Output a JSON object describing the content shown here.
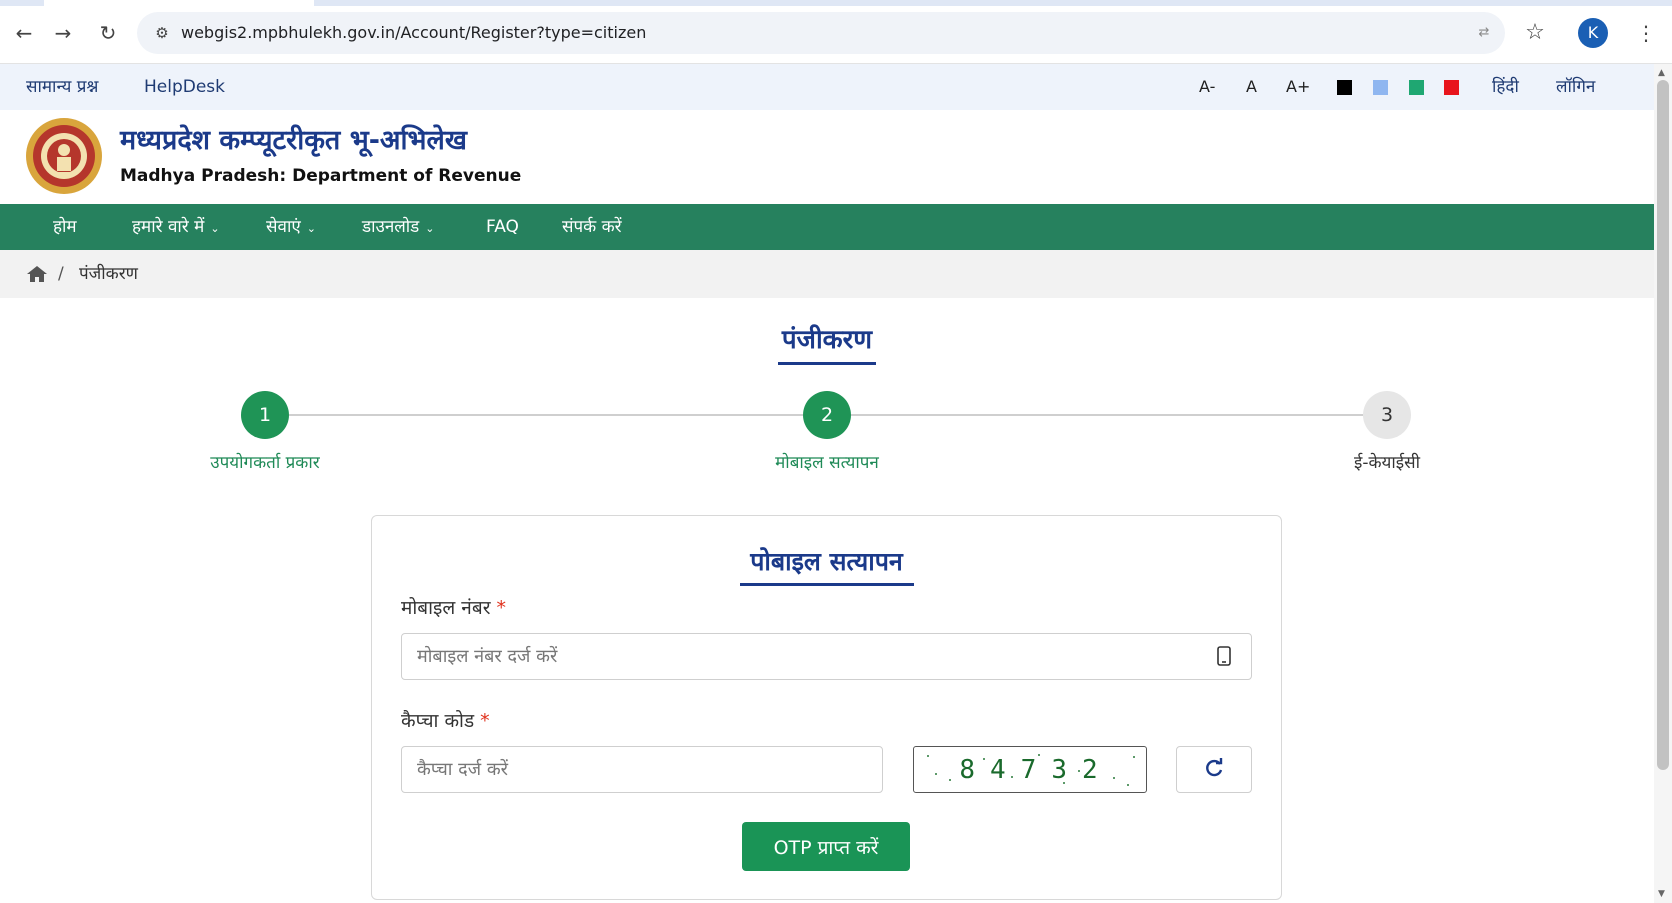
{
  "browser": {
    "url": "webgis2.mpbhulekh.gov.in/Account/Register?type=citizen",
    "profile_initial": "K",
    "icons": [
      "back-arrow-icon",
      "forward-arrow-icon",
      "reload-icon",
      "site-info-icon",
      "translate-icon",
      "star-icon",
      "kebab-menu-icon"
    ]
  },
  "utility_bar": {
    "faq_link": "सामान्य प्रश्न",
    "helpdesk_link": "HelpDesk",
    "font_decrease": "A-",
    "font_normal": "A",
    "font_increase": "A+",
    "themes": [
      "#000000",
      "#8fb6f0",
      "#1fa772",
      "#e8141c"
    ],
    "language": "हिंदी",
    "login": "लॉगिन"
  },
  "header": {
    "title_hindi": "मध्यप्रदेश कम्प्यूटरीकृत भू-अभिलेख",
    "title_english": "Madhya Pradesh: Department of Revenue"
  },
  "main_nav": {
    "items": [
      {
        "label": "होम"
      },
      {
        "label": "हमारे वारे में"
      },
      {
        "label": "सेवाएं"
      },
      {
        "label": "डाउनलोड"
      },
      {
        "label": "FAQ"
      },
      {
        "label": "संपर्क करें"
      }
    ]
  },
  "breadcrumb": {
    "separator": "/",
    "current": "पंजीकरण"
  },
  "page": {
    "title": "पंजीकरण"
  },
  "stepper": {
    "steps": [
      {
        "number": "1",
        "label": "उपयोगकर्ता प्रकार",
        "state": "done"
      },
      {
        "number": "2",
        "label": "मोबाइल सत्यापन",
        "state": "current"
      },
      {
        "number": "3",
        "label": "ई-केयाईसी",
        "state": "pending"
      }
    ]
  },
  "form": {
    "title": "पोबाइल सत्यापन",
    "mobile_label": "मोबाइल नंबर",
    "mobile_placeholder": "मोबाइल नंबर दर्ज करें",
    "captcha_label": "कैप्चा कोड",
    "captcha_placeholder": "कैप्चा दर्ज करें",
    "captcha_code": "84732",
    "required_mark": "*",
    "otp_button": "OTP प्राप्त करें"
  },
  "colors": {
    "nav_green": "#26815e",
    "button_green": "#1a9456",
    "heading_blue": "#1b3a8a",
    "required_red": "#e0311c"
  }
}
